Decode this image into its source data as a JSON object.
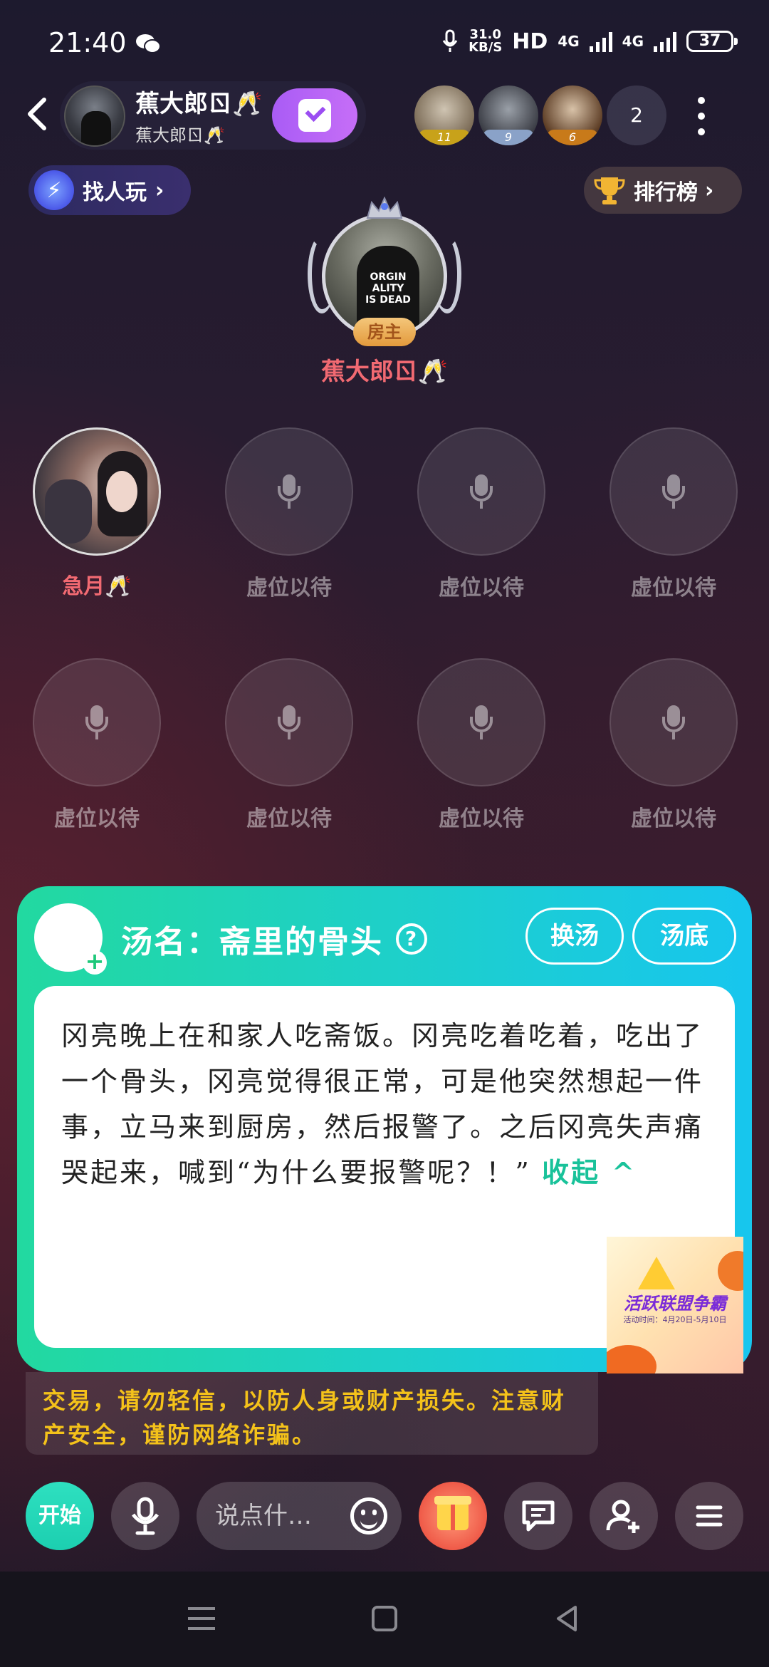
{
  "status_bar": {
    "time": "21:40",
    "net_speed_value": "31.0",
    "net_speed_unit": "KB/S",
    "hd": "HD",
    "net1": "4G",
    "net2": "4G",
    "battery": "37"
  },
  "header": {
    "host_name": "蕉大郎ㄖ🥂",
    "host_sub": "蕉大郎ㄖ🥂",
    "audience": [
      {
        "level": "11",
        "level_color": "#c8a21a"
      },
      {
        "level": "9",
        "level_color": "#8aa2c8"
      },
      {
        "level": "6",
        "level_color": "#c87a1a"
      }
    ],
    "audience_count": "2"
  },
  "pills": {
    "find_label": "找人玩",
    "rank_label": "排行榜"
  },
  "host": {
    "avatar_text": "ORGIN ALITY IS DEAD",
    "badge": "房主",
    "name": "蕉大郎ㄖ🥂"
  },
  "seats": {
    "user_name": "急月🥂",
    "empty_label": "虚位以待"
  },
  "game": {
    "title": "汤名：斋里的骨头",
    "change_label": "换汤",
    "base_label": "汤底",
    "story": "冈亮晚上在和家人吃斋饭。冈亮吃着吃着，吃出了一个骨头，冈亮觉得很正常，可是他突然想起一件事，立马来到厨房，然后报警了。之后冈亮失声痛哭起来，喊到“为什么要报警呢？！”",
    "collapse_label": "收起 ^",
    "banner_title": "活跃联盟争霸",
    "banner_sub": "活动时间：4月20日-5月10日"
  },
  "notice": {
    "text": "交易，请勿轻信，以防人身或财产损失。注意财产安全，谨防网络诈骗。"
  },
  "bottom_bar": {
    "start_label": "开始",
    "input_placeholder": "说点什…"
  },
  "colors": {
    "accent_teal": "#1ed0c8",
    "accent_purple": "#b066f6",
    "name_red": "#f26a72",
    "notice_yellow": "#f4c21a"
  }
}
